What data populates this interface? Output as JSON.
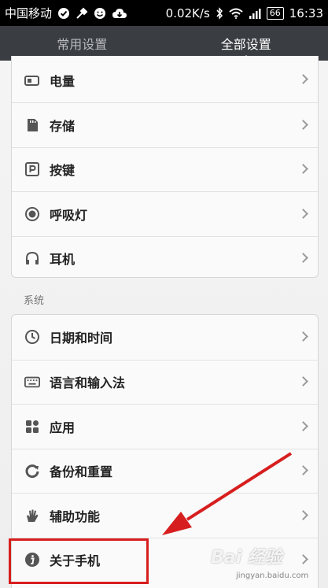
{
  "status_bar": {
    "carrier": "中国移动",
    "speed": "0.02K/s",
    "battery": "66",
    "time": "16:33"
  },
  "tabs": [
    {
      "label": "常用设置",
      "active": false
    },
    {
      "label": "全部设置",
      "active": true
    }
  ],
  "group1": {
    "items": [
      {
        "label": "电量",
        "icon": "battery-icon"
      },
      {
        "label": "存储",
        "icon": "sd-card-icon"
      },
      {
        "label": "按键",
        "icon": "key-p-icon"
      },
      {
        "label": "呼吸灯",
        "icon": "breathing-light-icon"
      },
      {
        "label": "耳机",
        "icon": "headphones-icon"
      }
    ]
  },
  "section_system": "系统",
  "group2": {
    "items": [
      {
        "label": "日期和时间",
        "icon": "clock-icon"
      },
      {
        "label": "语言和输入法",
        "icon": "keyboard-icon"
      },
      {
        "label": "应用",
        "icon": "apps-icon"
      },
      {
        "label": "备份和重置",
        "icon": "backup-icon"
      },
      {
        "label": "辅助功能",
        "icon": "hand-icon"
      },
      {
        "label": "关于手机",
        "icon": "info-icon"
      }
    ]
  },
  "watermark": {
    "text": "Bai 经验",
    "sub": "jingyan.baidu.com"
  },
  "colors": {
    "highlight": "#d71e1e",
    "tabbar": "#3a3d42"
  }
}
